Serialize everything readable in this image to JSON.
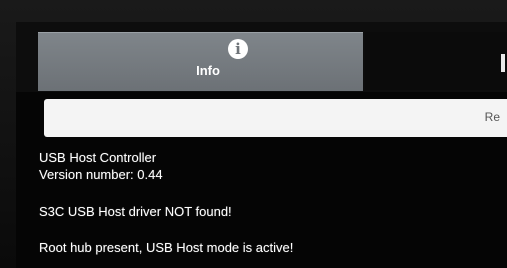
{
  "tabs": [
    {
      "label": "Info",
      "icon": "info-icon",
      "selected": true
    },
    {
      "label": "",
      "icon": "",
      "selected": false
    }
  ],
  "action_bar": {
    "label": "Re"
  },
  "content": {
    "controller_title": "USB Host Controller",
    "version": "Version number: 0.44",
    "driver_status": "S3C USB Host driver NOT found!",
    "hub_status": "Root hub present, USB Host mode is active!"
  },
  "colors": {
    "tab_selected": "#767c81",
    "background": "#050505",
    "text": "#ffffff",
    "input_bar": "#f4f4f4"
  }
}
